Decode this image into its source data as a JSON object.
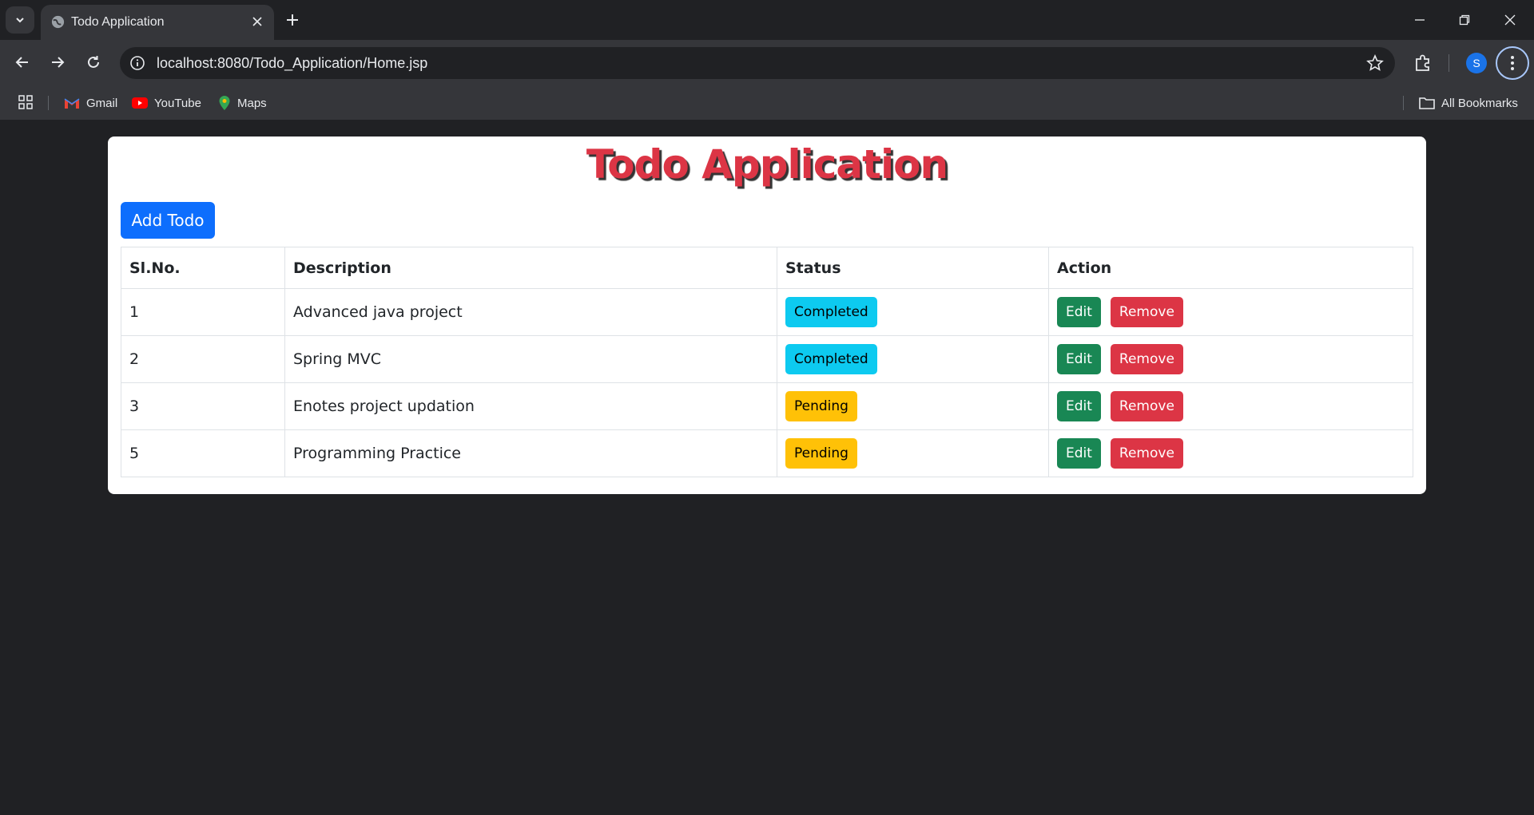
{
  "browser": {
    "tab_title": "Todo Application",
    "url": "localhost:8080/Todo_Application/Home.jsp",
    "profile_initial": "S",
    "bookmarks": [
      {
        "label": "Gmail",
        "icon": "gmail-icon"
      },
      {
        "label": "YouTube",
        "icon": "youtube-icon"
      },
      {
        "label": "Maps",
        "icon": "maps-icon"
      }
    ],
    "all_bookmarks_label": "All Bookmarks"
  },
  "page": {
    "title": "Todo Application",
    "add_button_label": "Add Todo",
    "table": {
      "headers": [
        "Sl.No.",
        "Description",
        "Status",
        "Action"
      ],
      "rows": [
        {
          "sl": "1",
          "description": "Advanced java project",
          "status": "Completed",
          "edit": "Edit",
          "remove": "Remove"
        },
        {
          "sl": "2",
          "description": "Spring MVC",
          "status": "Completed",
          "edit": "Edit",
          "remove": "Remove"
        },
        {
          "sl": "3",
          "description": "Enotes project updation",
          "status": "Pending",
          "edit": "Edit",
          "remove": "Remove"
        },
        {
          "sl": "5",
          "description": "Programming Practice",
          "status": "Pending",
          "edit": "Edit",
          "remove": "Remove"
        }
      ]
    }
  },
  "colors": {
    "title": "#dc3545",
    "add_button": "#0d6efd",
    "completed": "#0dcaf0",
    "pending": "#ffc107",
    "edit": "#198754",
    "remove": "#dc3545"
  }
}
